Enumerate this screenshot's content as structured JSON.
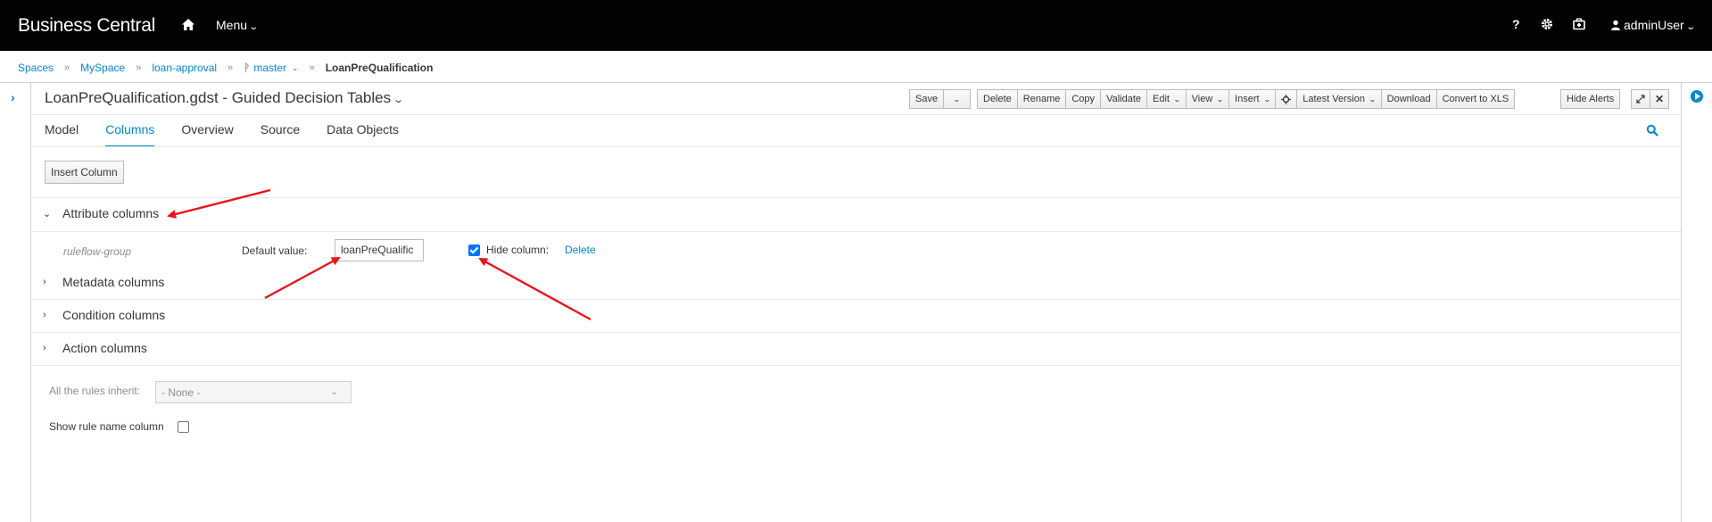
{
  "app": {
    "brand": "Business Central",
    "menu_label": "Menu",
    "user": "adminUser",
    "icons": [
      "home-icon",
      "help-icon",
      "gear-icon",
      "briefcase-icon",
      "user-icon"
    ]
  },
  "breadcrumb": {
    "spaces": "Spaces",
    "myspace": "MySpace",
    "project": "loan-approval",
    "branch": "master",
    "asset": "LoanPreQualification"
  },
  "editor": {
    "title": "LoanPreQualification.gdst - Guided Decision Tables",
    "toolbar": {
      "save": "Save",
      "delete": "Delete",
      "rename": "Rename",
      "copy": "Copy",
      "validate": "Validate",
      "edit": "Edit",
      "view": "View",
      "insert": "Insert",
      "latest_version": "Latest Version",
      "download": "Download",
      "convert": "Convert to XLS",
      "hide_alerts": "Hide Alerts"
    },
    "tabs": [
      "Model",
      "Columns",
      "Overview",
      "Source",
      "Data Objects"
    ],
    "active_tab": "Columns"
  },
  "columns": {
    "insert_button": "Insert Column",
    "sections": {
      "attribute": "Attribute columns",
      "metadata": "Metadata columns",
      "condition": "Condition columns",
      "action": "Action columns"
    },
    "attribute_row": {
      "name": "ruleflow-group",
      "default_label": "Default value:",
      "default_value": "loanPreQualific",
      "hide_label": "Hide column:",
      "hide_checked": true,
      "delete_link": "Delete"
    },
    "inherit_label": "All the rules inherit:",
    "inherit_value": "- None -",
    "rule_name_label": "Show rule name column",
    "rule_name_checked": false
  },
  "colors": {
    "accent": "#0088ce",
    "navbar": "#030303",
    "annotation_arrow": "#e8141c",
    "checkbox": "#0075ff"
  }
}
